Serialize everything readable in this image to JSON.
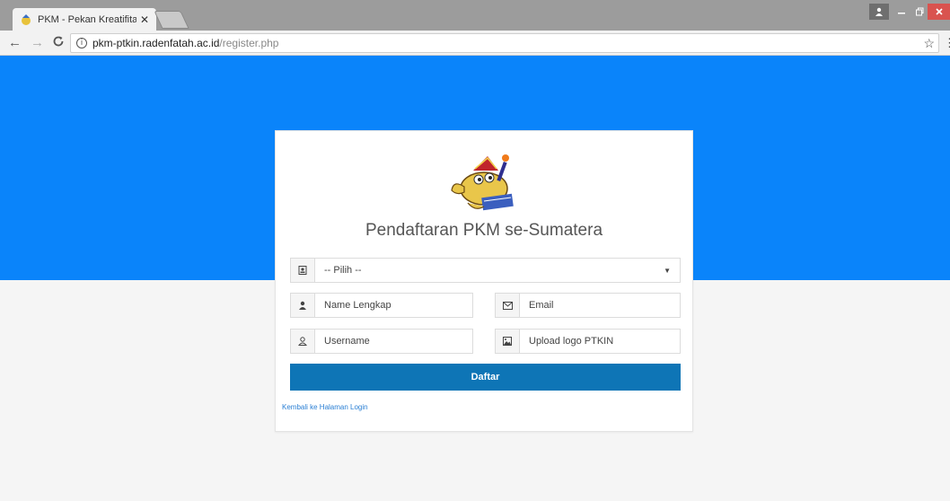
{
  "browser": {
    "tab_title": "PKM - Pekan Kreatifitas I",
    "tab_close": "✕",
    "url_host": "pkm-ptkin.radenfatah.ac.id",
    "url_path": "/register.php"
  },
  "page": {
    "title": "Pendaftaran PKM se-Sumatera",
    "select": {
      "selected": "-- Pilih --"
    },
    "name_field": {
      "placeholder": "Name Lengkap",
      "icon": "user-icon"
    },
    "email_field": {
      "placeholder": "Email",
      "icon": "envelope-icon"
    },
    "username_field": {
      "placeholder": "Username",
      "icon": "user-outline-icon"
    },
    "upload_field": {
      "placeholder": "Upload logo PTKIN",
      "icon": "image-icon"
    },
    "submit_label": "Daftar",
    "back_link": "Kembali ke Halaman Login"
  },
  "colors": {
    "hero": "#0a84fa",
    "button": "#0e75b6",
    "link": "#2a7fd4"
  }
}
